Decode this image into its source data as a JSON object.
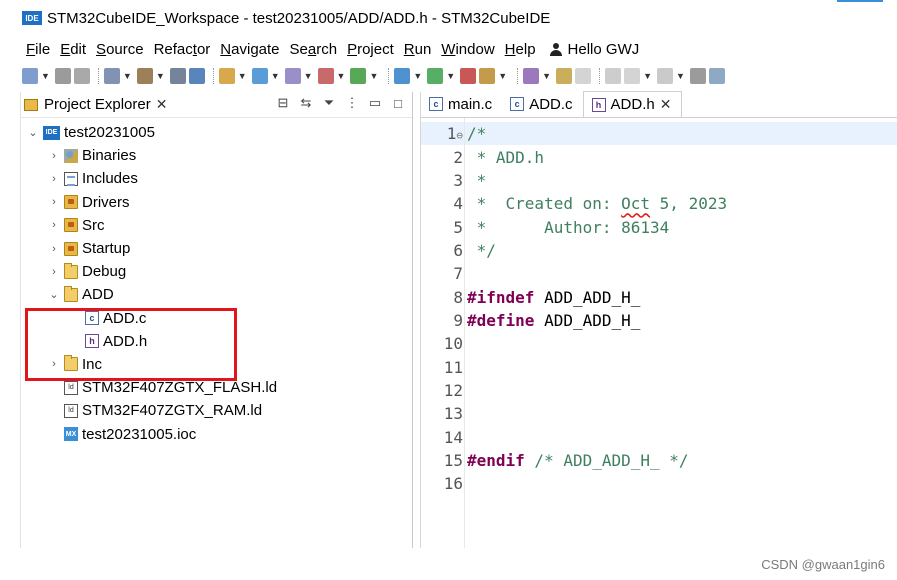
{
  "window": {
    "icon_text": "IDE",
    "title": "STM32CubeIDE_Workspace - test20231005/ADD/ADD.h - STM32CubeIDE"
  },
  "menu": {
    "items": [
      {
        "mnemonic": "F",
        "rest": "ile"
      },
      {
        "mnemonic": "E",
        "rest": "dit"
      },
      {
        "mnemonic": "S",
        "rest": "ource"
      },
      {
        "pre": "Refac",
        "mnemonic": "t",
        "rest": "or"
      },
      {
        "mnemonic": "N",
        "rest": "avigate"
      },
      {
        "pre": "Se",
        "mnemonic": "a",
        "rest": "rch"
      },
      {
        "mnemonic": "P",
        "rest": "roject"
      },
      {
        "mnemonic": "R",
        "rest": "un"
      },
      {
        "mnemonic": "W",
        "rest": "indow"
      },
      {
        "mnemonic": "H",
        "rest": "elp"
      }
    ],
    "user": "Hello GWJ"
  },
  "toolbar": {
    "icons": [
      "new-icon",
      "save-icon",
      "save-all-icon",
      "build-config-icon",
      "build-icon",
      "binary-icon",
      "debug-config-icon",
      "open-perspective-icon",
      "new-class-icon",
      "new-source-icon",
      "refactor-icon",
      "ext-tools-icon",
      "debug-icon",
      "run-icon",
      "coverage-icon",
      "open-type-icon",
      "search-icon",
      "pin-icon",
      "mark-icon",
      "block-icon",
      "whitespace-icon",
      "next-annotation-icon",
      "prev-annotation-icon",
      "back-icon"
    ],
    "colors": {
      "accent": "#1f6fc5"
    }
  },
  "explorer": {
    "tab_label": "Project Explorer",
    "tree": [
      {
        "depth": 0,
        "expanded": true,
        "icon": "project",
        "label": "test20231005"
      },
      {
        "depth": 1,
        "expanded": false,
        "icon": "binaries",
        "label": "Binaries"
      },
      {
        "depth": 1,
        "expanded": false,
        "icon": "includes",
        "label": "Includes"
      },
      {
        "depth": 1,
        "expanded": false,
        "icon": "srcfolder",
        "label": "Drivers"
      },
      {
        "depth": 1,
        "expanded": false,
        "icon": "srcfolder",
        "label": "Src"
      },
      {
        "depth": 1,
        "expanded": false,
        "icon": "srcfolder",
        "label": "Startup"
      },
      {
        "depth": 1,
        "expanded": false,
        "icon": "folder",
        "label": "Debug"
      },
      {
        "depth": 1,
        "expanded": true,
        "icon": "folder",
        "label": "ADD"
      },
      {
        "depth": 2,
        "expanded": null,
        "icon": "cfile",
        "label": "ADD.c"
      },
      {
        "depth": 2,
        "expanded": null,
        "icon": "hfile",
        "label": "ADD.h"
      },
      {
        "depth": 1,
        "expanded": false,
        "icon": "folder",
        "label": "Inc"
      },
      {
        "depth": 1,
        "expanded": null,
        "icon": "ld",
        "label": "STM32F407ZGTX_FLASH.ld"
      },
      {
        "depth": 1,
        "expanded": null,
        "icon": "ld",
        "label": "STM32F407ZGTX_RAM.ld"
      },
      {
        "depth": 1,
        "expanded": null,
        "icon": "mx",
        "label": "test20231005.ioc"
      }
    ],
    "highlight_color": "#e3141b"
  },
  "editor": {
    "tabs": [
      {
        "label": "main.c",
        "icon": "cfile",
        "active": false
      },
      {
        "label": "ADD.c",
        "icon": "cfile",
        "active": false
      },
      {
        "label": "ADD.h",
        "icon": "hfile",
        "active": true
      }
    ],
    "lines": [
      {
        "num": "1",
        "fold": true,
        "segments": [
          {
            "t": "/*",
            "c": "comment"
          }
        ]
      },
      {
        "num": "2",
        "segments": [
          {
            "t": " * ADD.h",
            "c": "comment"
          }
        ]
      },
      {
        "num": "3",
        "segments": [
          {
            "t": " *",
            "c": "comment"
          }
        ]
      },
      {
        "num": "4",
        "segments": [
          {
            "t": " *  Created on: ",
            "c": "comment"
          },
          {
            "t": "Oct",
            "c": "comment err"
          },
          {
            "t": " 5, 2023",
            "c": "comment"
          }
        ]
      },
      {
        "num": "5",
        "segments": [
          {
            "t": " *      Author: 86134",
            "c": "comment"
          }
        ]
      },
      {
        "num": "6",
        "segments": [
          {
            "t": " */",
            "c": "comment"
          }
        ]
      },
      {
        "num": "7",
        "segments": []
      },
      {
        "num": "8",
        "segments": [
          {
            "t": "#ifndef",
            "c": "dir"
          },
          {
            "t": " ADD_ADD_H_",
            "c": "plain"
          }
        ]
      },
      {
        "num": "9",
        "segments": [
          {
            "t": "#define",
            "c": "dir"
          },
          {
            "t": " ADD_ADD_H_",
            "c": "plain"
          }
        ]
      },
      {
        "num": "10",
        "segments": []
      },
      {
        "num": "11",
        "segments": []
      },
      {
        "num": "12",
        "segments": []
      },
      {
        "num": "13",
        "segments": []
      },
      {
        "num": "14",
        "segments": []
      },
      {
        "num": "15",
        "segments": [
          {
            "t": "#endif",
            "c": "dir"
          },
          {
            "t": " /* ADD_ADD_H_ */",
            "c": "comment"
          }
        ]
      },
      {
        "num": "16",
        "segments": []
      }
    ],
    "current_line": "1"
  },
  "watermark": "CSDN @gwaan1gin6"
}
